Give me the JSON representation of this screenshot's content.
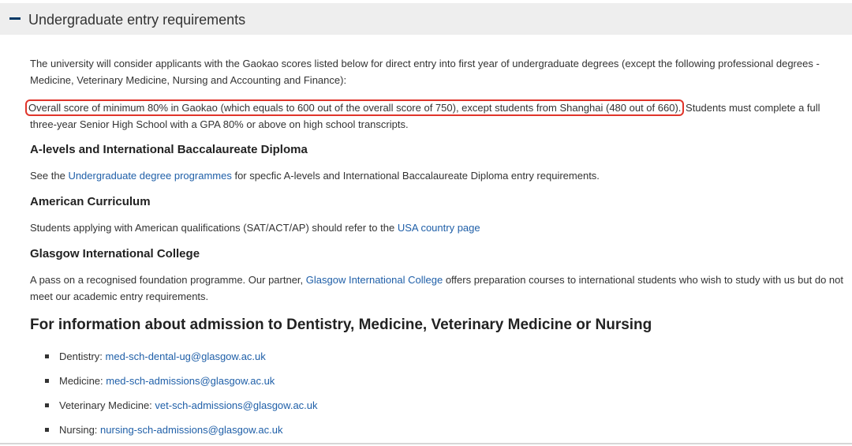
{
  "accordion": {
    "title": "Undergraduate entry requirements"
  },
  "intro": "The university will consider applicants with the Gaokao scores listed below for direct entry into first year of undergraduate degrees (except the following professional degrees - Medicine, Veterinary Medicine, Nursing and Accounting and Finance):",
  "gaokao": {
    "highlighted": "Overall score of minimum 80% in Gaokao (which equals to 600 out of the overall score of 750), except students from Shanghai (480 out of 660).",
    "rest": " Students must complete a full three-year Senior High School with a GPA 80% or above on high school transcripts."
  },
  "alevels": {
    "heading": "A-levels and International Baccalaureate Diploma",
    "before": "See the ",
    "link": "Undergraduate degree programmes",
    "after": " for specfic A-levels and International Baccalaureate Diploma entry requirements."
  },
  "american": {
    "heading": "American Curriculum",
    "before": "Students applying with American qualifications (SAT/ACT/AP) should refer to the ",
    "link": "USA country page"
  },
  "gic": {
    "heading": "Glasgow International College",
    "before": "A pass on a recognised foundation programme. Our partner, ",
    "link": "Glasgow International College",
    "after": " offers preparation courses to international students who wish to study with us but do not meet our academic entry requirements."
  },
  "admission": {
    "heading": "For information about admission to Dentistry, Medicine, Veterinary Medicine or Nursing",
    "contacts": [
      {
        "label": "Dentistry: ",
        "email": "med-sch-dental-ug@glasgow.ac.uk"
      },
      {
        "label": "Medicine: ",
        "email": "med-sch-admissions@glasgow.ac.uk"
      },
      {
        "label": "Veterinary Medicine: ",
        "email": "vet-sch-admissions@glasgow.ac.uk"
      },
      {
        "label": "Nursing: ",
        "email": "nursing-sch-admissions@glasgow.ac.uk"
      }
    ]
  },
  "colors": {
    "link": "#1f5fa8",
    "highlight_outline": "#e0352b",
    "header_bg": "#eeeeee",
    "icon": "#003865"
  }
}
